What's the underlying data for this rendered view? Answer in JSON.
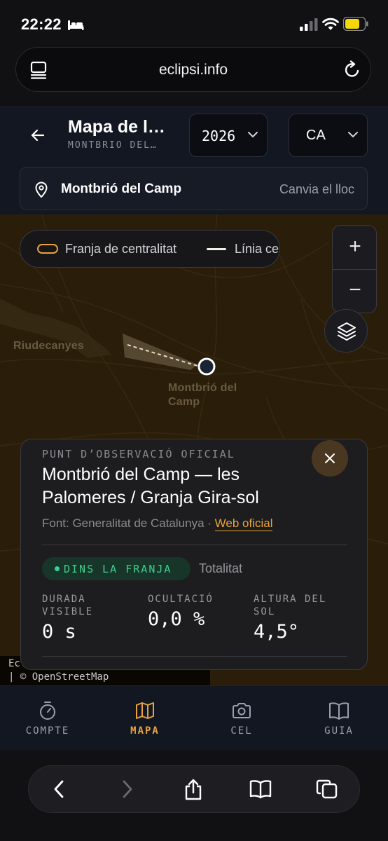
{
  "status_bar": {
    "time": "22:22"
  },
  "browser": {
    "url": "eclipsi.info"
  },
  "header": {
    "title": "Mapa de l…",
    "subtitle": "MONTBRIÓ DEL…",
    "year": "2026",
    "language": "CA"
  },
  "location": {
    "name": "Montbrió del Camp",
    "change_label": "Canvia el lloc"
  },
  "map": {
    "legend": {
      "band_label": "Franja de centralitat",
      "line_label": "Línia ce"
    },
    "zoom_in": "+",
    "zoom_out": "−",
    "places": {
      "riudecanyes": "Riudecanyes",
      "montbrio": "Montbrió del Camp"
    },
    "attribution_line1": "Ecli",
    "attribution_line2": "| © OpenStreetMap",
    "colors": {
      "land": "#2a1e0a",
      "band": "#e9a23b",
      "line": "#f3f0e6"
    }
  },
  "card": {
    "kicker": "PUNT D’OBSERVACIÓ OFICIAL",
    "title": "Montbrió del Camp — les Palomeres / Granja Gira-sol",
    "source_prefix": "Font: Generalitat de Catalunya · ",
    "source_link": "Web oficial",
    "badge": "DINS LA FRANJA",
    "badge_label": "Totalitat",
    "stats": [
      {
        "label": "DURADA VISIBLE",
        "value": "0 s"
      },
      {
        "label": "OCULTACIÓ",
        "value": "0,0 %"
      },
      {
        "label": "ALTURA DEL SOL",
        "value": "4,5°"
      }
    ]
  },
  "tabs": [
    {
      "label": "COMPTE",
      "icon": "stopwatch-icon",
      "active": false
    },
    {
      "label": "MAPA",
      "icon": "map-icon",
      "active": true
    },
    {
      "label": "CEL",
      "icon": "camera-icon",
      "active": false
    },
    {
      "label": "GUIA",
      "icon": "book-icon",
      "active": false
    }
  ]
}
